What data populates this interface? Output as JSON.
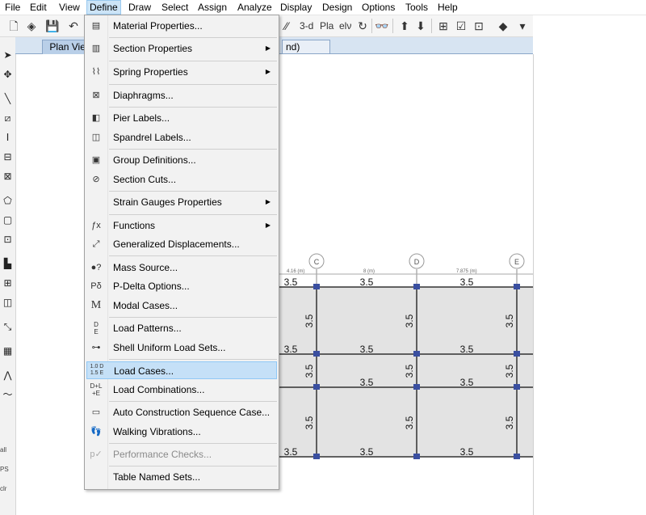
{
  "menubar": {
    "items": [
      "File",
      "Edit",
      "View",
      "Define",
      "Draw",
      "Select",
      "Assign",
      "Analyze",
      "Display",
      "Design",
      "Options",
      "Tools",
      "Help"
    ],
    "active": "Define"
  },
  "toolbar": {
    "three_d_label": "3-d",
    "plan_label": "Pla",
    "elev_label": "elν"
  },
  "tabs": {
    "plan_view": "Plan View",
    "other_tab_fragment": "nd)"
  },
  "define_menu": {
    "items": [
      {
        "label": "Material Properties...",
        "icon": "material-icon",
        "submenu": false,
        "highlighted": false,
        "disabled": false
      },
      {
        "label": "Section Properties",
        "icon": "section-icon",
        "submenu": true,
        "highlighted": false,
        "disabled": false
      },
      {
        "label": "Spring Properties",
        "icon": "spring-icon",
        "submenu": true,
        "highlighted": false,
        "disabled": false
      },
      {
        "label": "Diaphragms...",
        "icon": "diaphragm-icon",
        "submenu": false,
        "highlighted": false,
        "disabled": false
      },
      {
        "label": "Pier Labels...",
        "icon": "pier-icon",
        "submenu": false,
        "highlighted": false,
        "disabled": false
      },
      {
        "label": "Spandrel Labels...",
        "icon": "spandrel-icon",
        "submenu": false,
        "highlighted": false,
        "disabled": false
      },
      {
        "label": "Group Definitions...",
        "icon": "group-icon",
        "submenu": false,
        "highlighted": false,
        "disabled": false
      },
      {
        "label": "Section Cuts...",
        "icon": "section-cut-icon",
        "submenu": false,
        "highlighted": false,
        "disabled": false
      },
      {
        "label": "Strain Gauges Properties",
        "icon": "",
        "submenu": true,
        "highlighted": false,
        "disabled": false
      },
      {
        "label": "Functions",
        "icon": "function-icon",
        "submenu": true,
        "highlighted": false,
        "disabled": false
      },
      {
        "label": "Generalized Displacements...",
        "icon": "displacement-icon",
        "submenu": false,
        "highlighted": false,
        "disabled": false
      },
      {
        "label": "Mass Source...",
        "icon": "mass-icon",
        "submenu": false,
        "highlighted": false,
        "disabled": false
      },
      {
        "label": "P-Delta Options...",
        "icon": "pdelta-icon",
        "submenu": false,
        "highlighted": false,
        "disabled": false
      },
      {
        "label": "Modal Cases...",
        "icon": "modal-icon",
        "submenu": false,
        "highlighted": false,
        "disabled": false
      },
      {
        "label": "Load Patterns...",
        "icon": "load-pattern-icon",
        "submenu": false,
        "highlighted": false,
        "disabled": false
      },
      {
        "label": "Shell Uniform Load Sets...",
        "icon": "shell-load-icon",
        "submenu": false,
        "highlighted": false,
        "disabled": false
      },
      {
        "label": "Load Cases...",
        "icon": "load-case-icon",
        "submenu": false,
        "highlighted": true,
        "disabled": false
      },
      {
        "label": "Load Combinations...",
        "icon": "load-combo-icon",
        "submenu": false,
        "highlighted": false,
        "disabled": false
      },
      {
        "label": "Auto Construction Sequence Case...",
        "icon": "construction-icon",
        "submenu": false,
        "highlighted": false,
        "disabled": false
      },
      {
        "label": "Walking Vibrations...",
        "icon": "footprint-icon",
        "submenu": false,
        "highlighted": false,
        "disabled": false
      },
      {
        "label": "Performance Checks...",
        "icon": "performance-icon",
        "submenu": false,
        "highlighted": false,
        "disabled": true
      },
      {
        "label": "Table Named Sets...",
        "icon": "",
        "submenu": false,
        "highlighted": false,
        "disabled": false
      }
    ],
    "icon_glyphs": {
      "pdelta": "Pδ",
      "modal": "M",
      "load_pattern_top": "D",
      "load_pattern_bottom": "E",
      "load_case_top": "1.0 D",
      "load_case_bottom": "1.5 E",
      "load_combo_top": "D+L",
      "load_combo_bottom": "+E",
      "function": "ƒx"
    }
  },
  "drawing": {
    "grid_labels": [
      "C",
      "D",
      "E"
    ],
    "dim_labels": [
      "4.16 (m)",
      "8 (m)",
      "7.875 (m)"
    ],
    "beam_value": "3.5",
    "left_labels": [
      "all",
      "PS",
      "clr"
    ]
  },
  "colors": {
    "menu_highlight": "#c5e0f7",
    "tab_strip": "#d7e4f2",
    "joint": "#3a4fa0",
    "slab": "#e3e3e3"
  }
}
